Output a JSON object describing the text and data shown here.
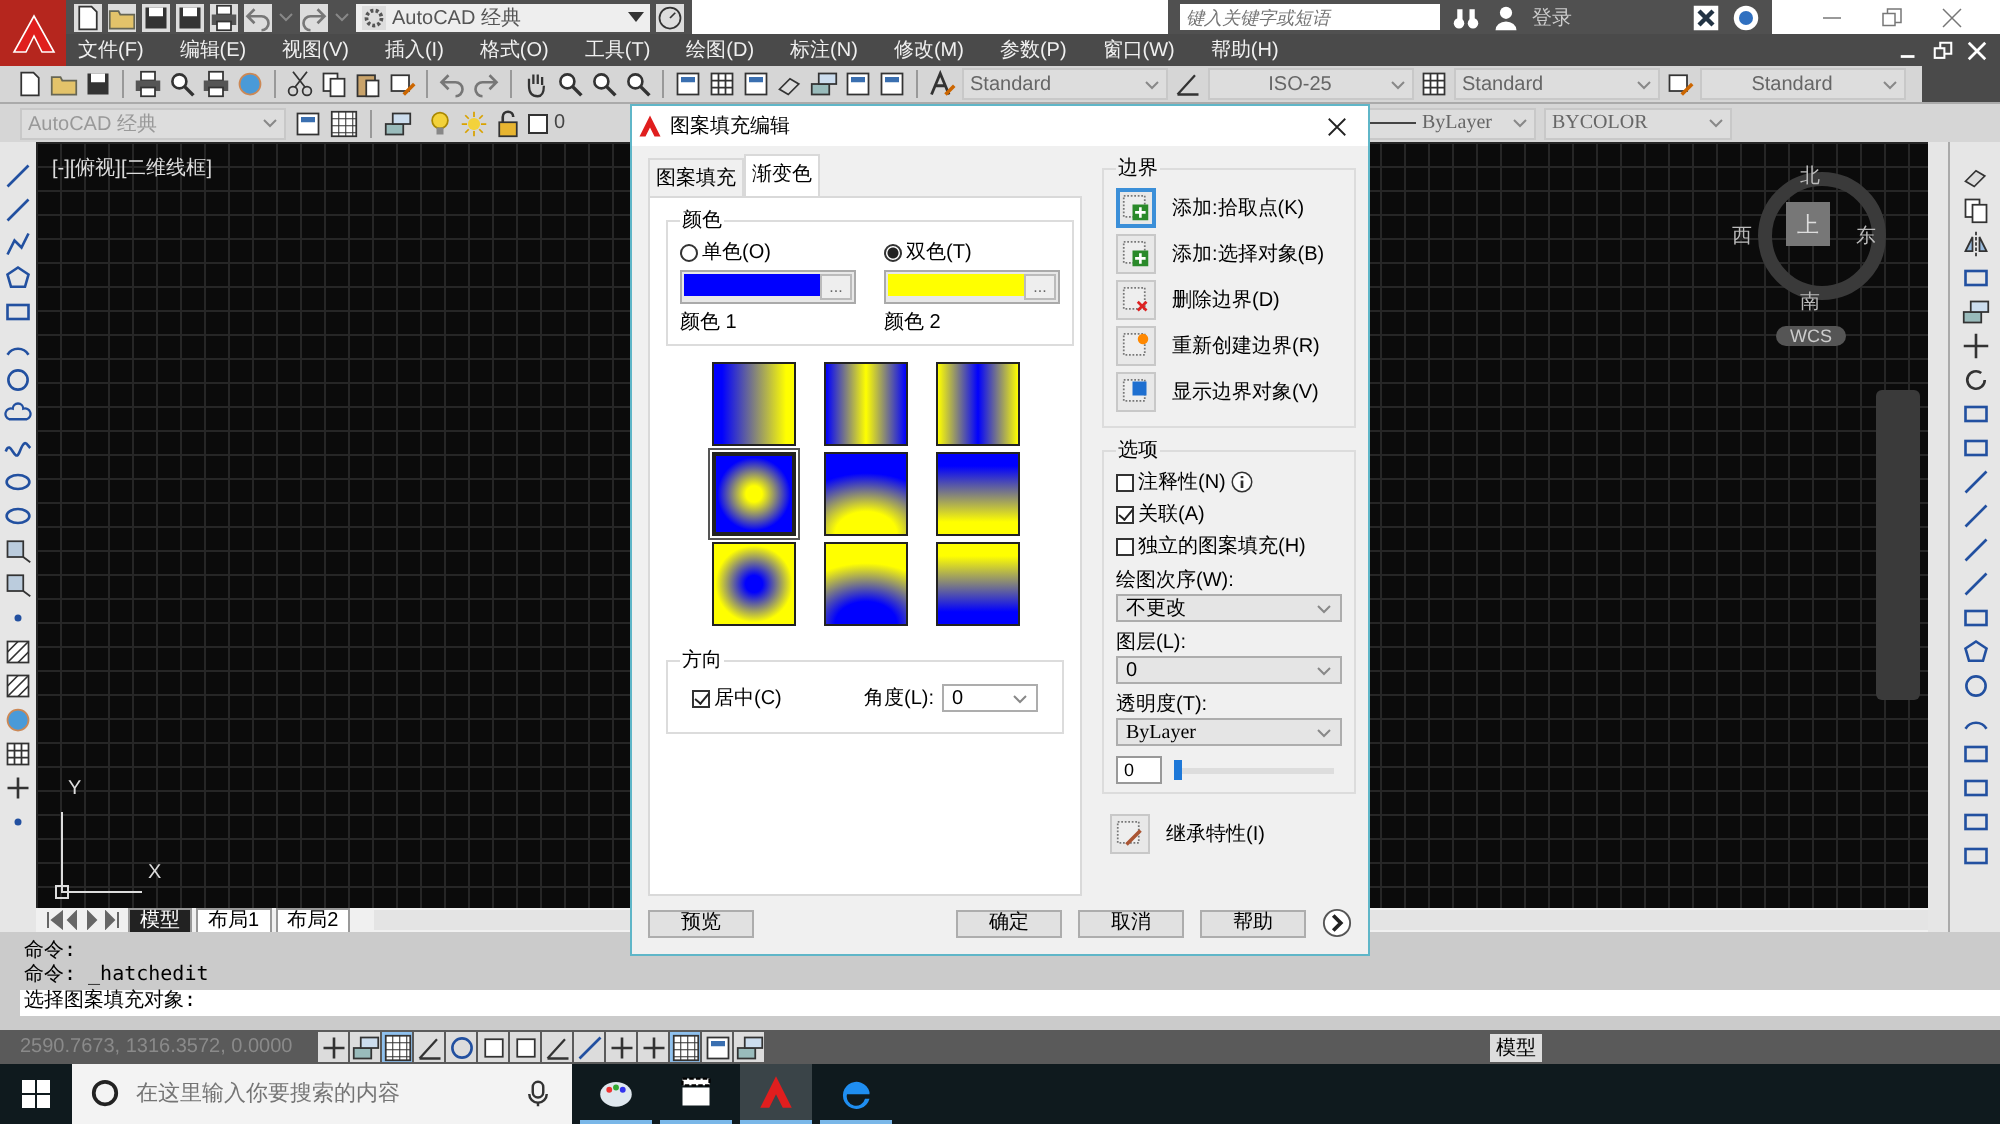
{
  "title_bar": {
    "workspace": "AutoCAD 经典",
    "search": {
      "placeholder": "键入关键字或短语"
    },
    "sign_in": "登录"
  },
  "menu": [
    "文件(F)",
    "编辑(E)",
    "视图(V)",
    "插入(I)",
    "格式(O)",
    "工具(T)",
    "绘图(D)",
    "标注(N)",
    "修改(M)",
    "参数(P)",
    "窗口(W)",
    "帮助(H)"
  ],
  "styles_toolbar": {
    "text_style": "Standard",
    "dimension_style": "ISO-25",
    "table_style": "Standard",
    "multileader_style": "Standard"
  },
  "properties_toolbar": {
    "workspace": "AutoCAD 经典",
    "layer": "0",
    "linetype": "ByLayer",
    "plot_style": "BYCOLOR"
  },
  "viewport": {
    "label": "[-][俯视][二维线框]",
    "north": "北",
    "south": "南",
    "east": "东",
    "west": "西",
    "top": "上",
    "ucs_name": "WCS",
    "axis_x": "X",
    "axis_y": "Y"
  },
  "layout_tabs": [
    {
      "label": "模型",
      "selected": true
    },
    {
      "label": "布局1",
      "selected": false
    },
    {
      "label": "布局2",
      "selected": false
    }
  ],
  "command_history": [
    "命令:",
    "命令: _hatchedit"
  ],
  "command_prompt": "选择图案填充对象:",
  "status_bar": {
    "coordinates": "2590.7673, 1316.3572, 0.0000",
    "toggles": [
      {
        "on": false
      },
      {
        "on": false
      },
      {
        "on": true
      },
      {
        "on": false
      },
      {
        "on": false
      },
      {
        "on": false
      },
      {
        "on": false
      },
      {
        "on": false
      },
      {
        "on": false
      },
      {
        "on": false
      },
      {
        "on": false
      },
      {
        "on": true
      },
      {
        "on": false
      },
      {
        "on": false
      }
    ],
    "space": "模型"
  },
  "taskbar": {
    "search": {
      "placeholder": "在这里输入你要搜索的内容"
    }
  },
  "dialog": {
    "title": "图案填充编辑",
    "tabs": [
      {
        "label": "图案填充",
        "selected": false
      },
      {
        "label": "渐变色",
        "selected": true
      }
    ],
    "color_group": {
      "title": "颜色",
      "modes": [
        {
          "label": "单色(O)",
          "selected": false
        },
        {
          "label": "双色(T)",
          "selected": true
        }
      ],
      "swatches": [
        {
          "label": "颜色 1",
          "color": "#0000ff",
          "button": "..."
        },
        {
          "label": "颜色 2",
          "color": "#ffff00",
          "button": "..."
        }
      ]
    },
    "gradients": [
      {
        "kind": "linear",
        "selected": false
      },
      {
        "kind": "inv-cylinder",
        "selected": false
      },
      {
        "kind": "cylinder",
        "selected": false
      },
      {
        "kind": "spherical",
        "selected": true
      },
      {
        "kind": "hemispherical",
        "selected": false
      },
      {
        "kind": "curved",
        "selected": false
      },
      {
        "kind": "inv-spherical",
        "selected": false
      },
      {
        "kind": "inv-hemispherical",
        "selected": false
      },
      {
        "kind": "inv-curved",
        "selected": false
      }
    ],
    "orientation": {
      "title": "方向",
      "centered": {
        "label": "居中(C)",
        "checked": true
      },
      "angle_label": "角度(L):",
      "angle": "0"
    },
    "boundary": {
      "title": "边界",
      "buttons": [
        {
          "kind": "add-pick",
          "label": "添加:拾取点(K)",
          "selected": true
        },
        {
          "kind": "add-select",
          "label": "添加:选择对象(B)",
          "selected": false
        },
        {
          "kind": "remove",
          "label": "删除边界(D)",
          "selected": false
        },
        {
          "kind": "recreate",
          "label": "重新创建边界(R)",
          "selected": false
        },
        {
          "kind": "show",
          "label": "显示边界对象(V)",
          "selected": false
        }
      ]
    },
    "options": {
      "title": "选项",
      "checks": [
        {
          "label": "注释性(N)",
          "checked": false,
          "info": true
        },
        {
          "label": "关联(A)",
          "checked": true,
          "info": false
        },
        {
          "label": "独立的图案填充(H)",
          "checked": false,
          "info": false
        }
      ],
      "draw_order_label": "绘图次序(W):",
      "draw_order": "不更改",
      "layer_label": "图层(L):",
      "layer": "0",
      "transparency_label": "透明度(T):",
      "transparency": "ByLayer",
      "transparency_value": "0",
      "transparency_slider": {
        "level": 0
      }
    },
    "inherit": "继承特性(I)",
    "buttons": [
      "预览",
      "确定",
      "取消",
      "帮助"
    ]
  }
}
